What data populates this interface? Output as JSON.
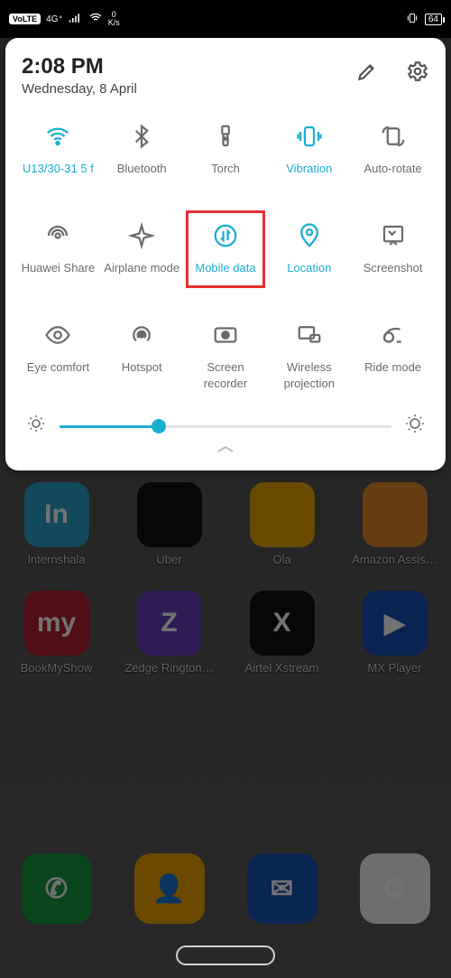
{
  "status": {
    "network_label": "4G⁺",
    "speed_top": "0",
    "speed_bottom": "K/s",
    "battery": "64"
  },
  "panel": {
    "time": "2:08 PM",
    "date": "Wednesday, 8 April",
    "brightness_pct": 30
  },
  "tiles": [
    {
      "label": "U13/30-31 5 f",
      "active": true,
      "icon": "wifi"
    },
    {
      "label": "Bluetooth",
      "active": false,
      "icon": "bluetooth"
    },
    {
      "label": "Torch",
      "active": false,
      "icon": "torch"
    },
    {
      "label": "Vibration",
      "active": true,
      "icon": "vibration"
    },
    {
      "label": "Auto-rotate",
      "active": false,
      "icon": "rotate"
    },
    {
      "label": "Huawei Share",
      "active": false,
      "icon": "share"
    },
    {
      "label": "Airplane mode",
      "active": false,
      "icon": "airplane"
    },
    {
      "label": "Mobile data",
      "active": true,
      "icon": "mobiledata",
      "highlight": true
    },
    {
      "label": "Location",
      "active": true,
      "icon": "location"
    },
    {
      "label": "Screenshot",
      "active": false,
      "icon": "screenshot"
    },
    {
      "label": "Eye comfort",
      "active": false,
      "icon": "eye"
    },
    {
      "label": "Hotspot",
      "active": false,
      "icon": "hotspot"
    },
    {
      "label": "Screen",
      "label2": "recorder",
      "active": false,
      "icon": "recorder"
    },
    {
      "label": "Wireless",
      "label2": "projection",
      "active": false,
      "icon": "projection"
    },
    {
      "label": "Ride mode",
      "active": false,
      "icon": "ride"
    }
  ],
  "apps_row1": [
    {
      "name": "Internshala",
      "color": "c-teal",
      "glyph": "In"
    },
    {
      "name": "Uber",
      "color": "c-black",
      "glyph": ""
    },
    {
      "name": "Ola",
      "color": "c-yellow",
      "glyph": ""
    },
    {
      "name": "Amazon Assis…",
      "color": "c-orange",
      "glyph": ""
    }
  ],
  "apps_row2": [
    {
      "name": "BookMyShow",
      "color": "c-red",
      "glyph": "my"
    },
    {
      "name": "Zedge Rington…",
      "color": "c-purple",
      "glyph": "Z"
    },
    {
      "name": "Airtel Xstream",
      "color": "c-black",
      "glyph": "X"
    },
    {
      "name": "MX Player",
      "color": "c-blue",
      "glyph": "▶"
    }
  ],
  "dock": [
    {
      "name": "",
      "color": "c-green",
      "glyph": "✆"
    },
    {
      "name": "",
      "color": "c-amber",
      "glyph": "👤"
    },
    {
      "name": "",
      "color": "c-blue2",
      "glyph": "✉"
    },
    {
      "name": "",
      "color": "c-white",
      "glyph": "⚙"
    }
  ]
}
